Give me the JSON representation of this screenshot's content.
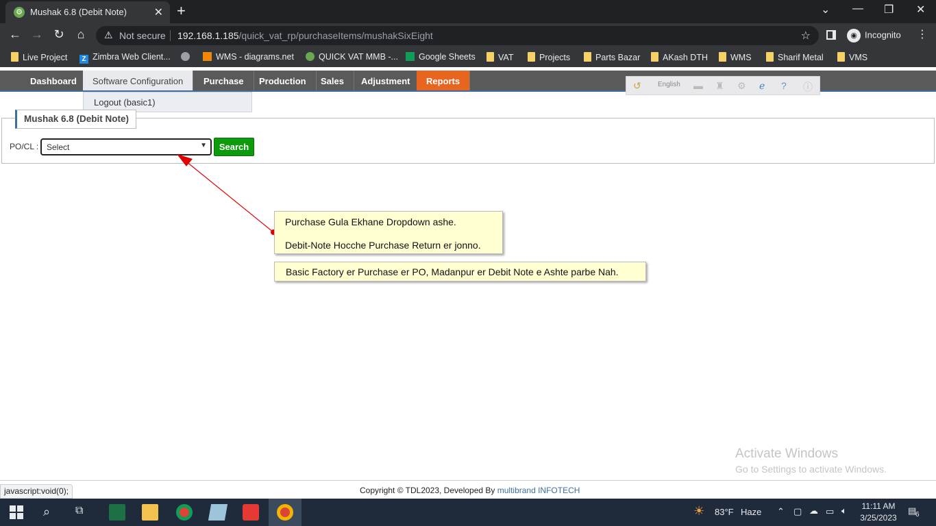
{
  "browser": {
    "tab_title": "Mushak 6.8 (Debit Note)",
    "tab_favicon": "gear-icon",
    "new_tab_label": "+",
    "security_label": "Not secure",
    "url_host": "192.168.1.185",
    "url_path": "/quick_vat_rp/purchaseItems/mushakSixEight",
    "profile_label": "Incognito",
    "bookmarks": [
      {
        "label": "Live Project",
        "icon": "folder"
      },
      {
        "label": "Zimbra Web Client...",
        "icon": "zimbra"
      },
      {
        "label": "",
        "icon": "globe"
      },
      {
        "label": "WMS - diagrams.net",
        "icon": "drawio"
      },
      {
        "label": "QUICK VAT MMB -...",
        "icon": "quickvat"
      },
      {
        "label": "Google Sheets",
        "icon": "sheets"
      },
      {
        "label": "VAT",
        "icon": "folder"
      },
      {
        "label": "Projects",
        "icon": "folder"
      },
      {
        "label": "Parts Bazar",
        "icon": "folder"
      },
      {
        "label": "AKash DTH",
        "icon": "folder"
      },
      {
        "label": "WMS",
        "icon": "folder"
      },
      {
        "label": "Sharif Metal",
        "icon": "folder"
      },
      {
        "label": "VMS",
        "icon": "folder"
      }
    ],
    "status_url": "javascript:void(0);"
  },
  "nav": {
    "items": [
      "Dashboard",
      "Software Configuration",
      "Purchase",
      "Production",
      "Sales",
      "Adjustment",
      "Reports"
    ],
    "active": "Reports",
    "hovered": "Software Configuration",
    "language": "English"
  },
  "dropdown_menu": {
    "items": [
      "Logout (basic1)"
    ]
  },
  "page": {
    "title": "Mushak 6.8 (Debit Note)",
    "po_label": "PO/CL :",
    "select_value": "Select",
    "search_button": "Search"
  },
  "annotations": {
    "note1_line1": "Purchase Gula Ekhane Dropdown ashe.",
    "note1_line2": "Debit-Note Hocche Purchase Return er jonno.",
    "note2": "Basic Factory er Purchase er PO, Madanpur er Debit Note e Ashte parbe Nah.",
    "arrow_color": "#e00000"
  },
  "footer": {
    "copyright": "Copyright © TDL2023, Developed By ",
    "developer": "multibrand INFOTECH"
  },
  "watermark": {
    "line1": "Activate Windows",
    "line2": "Go to Settings to activate Windows."
  },
  "taskbar": {
    "weather_temp": "83°F",
    "weather_desc": "Haze",
    "time": "11:11 AM",
    "date": "3/25/2023",
    "notification_count": "6"
  }
}
